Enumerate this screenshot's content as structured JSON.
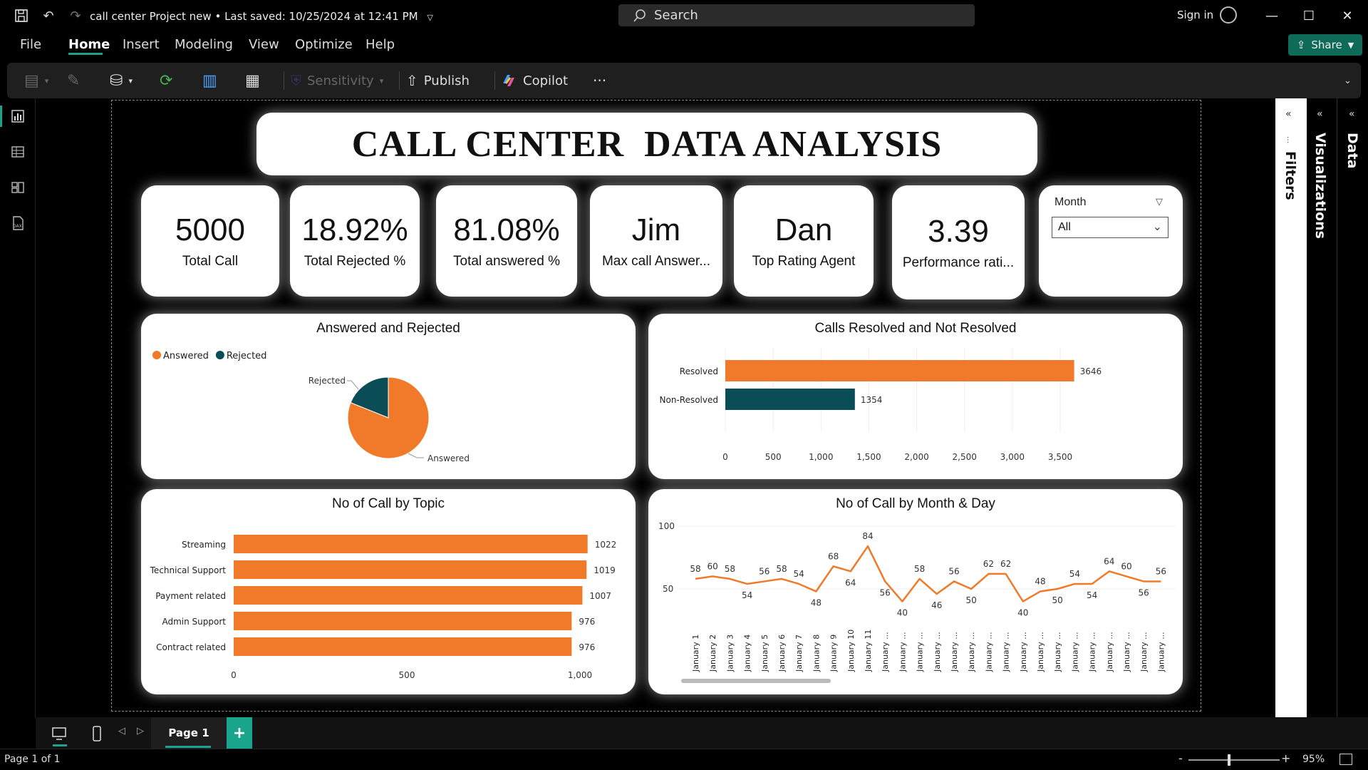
{
  "titlebar": {
    "doc_title": "call center Project new",
    "saved": "Last saved: 10/25/2024 at 12:41 PM",
    "search_placeholder": "Search",
    "signin": "Sign in"
  },
  "menu": {
    "file": "File",
    "home": "Home",
    "insert": "Insert",
    "modeling": "Modeling",
    "view": "View",
    "optimize": "Optimize",
    "help": "Help",
    "share": "Share"
  },
  "ribbon": {
    "sensitivity": "Sensitivity",
    "publish": "Publish",
    "copilot": "Copilot",
    "more": "···"
  },
  "dashboard": {
    "title": "CALL CENTER  DATA ANALYSIS",
    "kpis": [
      {
        "value": "5000",
        "label": "Total Call"
      },
      {
        "value": "18.92%",
        "label": "Total Rejected %"
      },
      {
        "value": "81.08%",
        "label": "Total answered %"
      },
      {
        "value": "Jim",
        "label": "Max call Answer..."
      },
      {
        "value": "Dan",
        "label": "Top Rating Agent"
      },
      {
        "value": "3.39",
        "label": "Performance rati..."
      }
    ],
    "slicer": {
      "label": "Month",
      "value": "All"
    }
  },
  "chart_data": [
    {
      "type": "pie",
      "title": "Answered and Rejected",
      "legend": [
        "Answered",
        "Rejected"
      ],
      "legend_position": "top-left",
      "slices": [
        {
          "name": "Answered",
          "value": 81.08,
          "color": "#f07a2a"
        },
        {
          "name": "Rejected",
          "value": 18.92,
          "color": "#0b4d57"
        }
      ]
    },
    {
      "type": "bar",
      "orientation": "horizontal",
      "title": "Calls Resolved and Not Resolved",
      "categories": [
        "Resolved",
        "Non-Resolved"
      ],
      "values": [
        3646,
        1354
      ],
      "colors": [
        "#f07a2a",
        "#0b4d57"
      ],
      "xlim": [
        0,
        3700
      ],
      "xticks": [
        "0",
        "500",
        "1,000",
        "1,500",
        "2,000",
        "2,500",
        "3,000",
        "3,500"
      ],
      "grid": true
    },
    {
      "type": "bar",
      "orientation": "horizontal",
      "title": "No of Call  by Topic",
      "categories": [
        "Streaming",
        "Technical Support",
        "Payment related",
        "Admin Support",
        "Contract related"
      ],
      "values": [
        1022,
        1019,
        1007,
        976,
        976
      ],
      "color": "#f07a2a",
      "xlim": [
        0,
        1000
      ],
      "xticks": [
        "0",
        "500",
        "1,000"
      ]
    },
    {
      "type": "line",
      "title": "No of Call by Month & Day",
      "color": "#f07a2a",
      "y_ticks": [
        "100",
        "50"
      ],
      "ylim": [
        30,
        100
      ],
      "x": [
        "January 1",
        "January 2",
        "January 3",
        "January 4",
        "January 5",
        "January 6",
        "January 7",
        "January 8",
        "January 9",
        "January 10",
        "January 11",
        "January ...",
        "January ...",
        "January ...",
        "January ...",
        "January ...",
        "January ...",
        "January ...",
        "January ...",
        "January ...",
        "January ...",
        "January ...",
        "January ...",
        "January ...",
        "January ...",
        "January ...",
        "January ...",
        "January ..."
      ],
      "values": [
        58,
        60,
        58,
        54,
        56,
        58,
        54,
        48,
        68,
        64,
        84,
        56,
        40,
        58,
        46,
        56,
        50,
        62,
        62,
        40,
        48,
        50,
        54,
        54,
        64,
        60,
        56,
        56
      ]
    }
  ],
  "pagebar": {
    "page": "Page 1",
    "status": "Page 1 of 1",
    "zoom": "95%"
  },
  "panes": {
    "filters": "Filters",
    "visualizations": "Visualizations",
    "data": "Data"
  }
}
